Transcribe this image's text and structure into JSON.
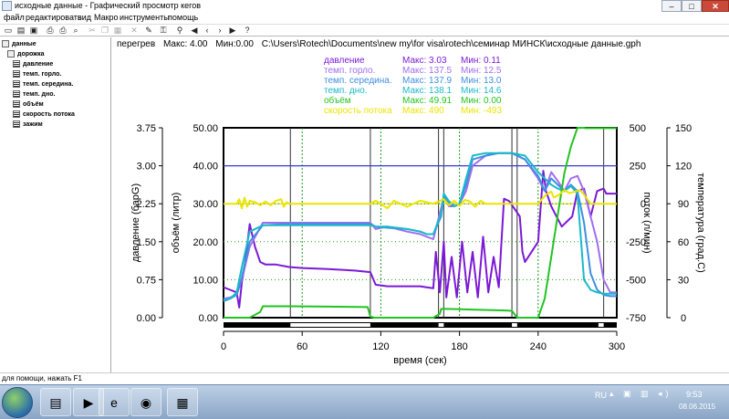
{
  "window": {
    "title": "исходные данные - Графический просмотр кегов",
    "min_label": "–",
    "max_label": "□",
    "close_label": "✕"
  },
  "menu": [
    "файл",
    "редактировать",
    "вид",
    "Макро",
    "инструменты",
    "помощь"
  ],
  "toolbar_icons": [
    "new-icon",
    "open-icon",
    "save-icon",
    "print-preview-icon",
    "print-icon",
    "search-icon",
    "cut-icon",
    "copy-icon",
    "paste-icon",
    "delete-icon",
    "pen-icon",
    "key-icon",
    "arrow-left-icon",
    "arrow-left-small-icon",
    "arrow-right-small-icon",
    "arrow-right-icon",
    "help-icon"
  ],
  "tree": {
    "root": "данные",
    "branch": "дорожка",
    "channels": [
      "давление",
      "темп. горло.",
      "темп. середина.",
      "темп. дно.",
      "объём",
      "скорость потока",
      "зажим"
    ]
  },
  "header": {
    "label": "перегрев",
    "max": "Макс: 4.00",
    "min": "Мин:0.00",
    "path": "C:\\Users\\Rotech\\Documents\\new my\\for visa\\rotech\\семинар МИНСК\\исходные данные.gph"
  },
  "legend": [
    {
      "name": "давление",
      "max": "Макс: 3.03",
      "min": "Мин: 0.11",
      "color": "#7b19d6"
    },
    {
      "name": "темп. горло.",
      "max": "Макс: 137.5",
      "min": "Мин: 12.5",
      "color": "#a16ef0"
    },
    {
      "name": "темп. середина.",
      "max": "Макс: 137.9",
      "min": "Мин: 13.0",
      "color": "#3f8fe0"
    },
    {
      "name": "темп. дно.",
      "max": "Макс: 138.1",
      "min": "Мин: 14.6",
      "color": "#19b9c9"
    },
    {
      "name": "объём",
      "max": "Макс: 49.91",
      "min": "Мин: 0.00",
      "color": "#22c322"
    },
    {
      "name": "скорость потока",
      "max": "Макс: 490",
      "min": "Мин: -493",
      "color": "#ece400"
    }
  ],
  "chart_data": {
    "type": "line",
    "x": {
      "label": "время (сек)",
      "range": [
        0,
        300
      ],
      "ticks": [
        "0",
        "60",
        "120",
        "180",
        "240",
        "300"
      ]
    },
    "y_pressure": {
      "label": "давление (барG)",
      "range": [
        0,
        3.75
      ],
      "ticks": [
        "0.00",
        "0.75",
        "1.50",
        "2.25",
        "3.00",
        "3.75"
      ]
    },
    "y_volume": {
      "label": "объём (литр)",
      "range": [
        0,
        50
      ],
      "ticks": [
        "0.00",
        "10.00",
        "20.00",
        "30.00",
        "40.00",
        "50.00"
      ]
    },
    "y_flow": {
      "label": "поток (л/мин)",
      "range": [
        -750,
        500
      ],
      "ticks": [
        "-750",
        "-500",
        "-250",
        "0",
        "250",
        "500"
      ]
    },
    "y_temp": {
      "label": "температура (град.C)",
      "range": [
        0,
        150
      ],
      "ticks": [
        "0",
        "30",
        "60",
        "90",
        "120",
        "150"
      ]
    },
    "horizontal_refs": [
      {
        "axis": "volume",
        "value": 40,
        "color": "#3a3ad0"
      },
      {
        "axis": "flow",
        "value": 0,
        "color": "#d8d800"
      }
    ],
    "vertical_lines": [
      {
        "t": 51,
        "style": "solid"
      },
      {
        "t": 60,
        "style": "dotted"
      },
      {
        "t": 112,
        "style": "solid"
      },
      {
        "t": 120,
        "style": "dotted"
      },
      {
        "t": 164,
        "style": "solid"
      },
      {
        "t": 168,
        "style": "solid"
      },
      {
        "t": 180,
        "style": "dotted"
      },
      {
        "t": 220,
        "style": "solid"
      },
      {
        "t": 224,
        "style": "solid"
      },
      {
        "t": 240,
        "style": "dotted"
      },
      {
        "t": 290,
        "style": "solid"
      }
    ],
    "timeline_white": [
      [
        51,
        112
      ],
      [
        164,
        168
      ],
      [
        220,
        224
      ],
      [
        286,
        290
      ]
    ],
    "series": [
      {
        "name": "давление",
        "axis": "pressure",
        "color": "#7b19d6",
        "x": [
          0,
          5,
          10,
          12,
          14,
          16,
          20,
          24,
          28,
          32,
          36,
          40,
          50,
          60,
          80,
          100,
          112,
          116,
          125,
          140,
          150,
          155,
          160,
          162,
          165,
          168,
          170,
          174,
          178,
          182,
          186,
          190,
          194,
          198,
          202,
          206,
          210,
          214,
          218,
          222,
          226,
          228,
          230,
          235,
          240,
          244,
          246,
          250,
          254,
          258,
          262,
          266,
          270,
          275,
          280,
          285,
          290,
          292,
          296,
          300
        ],
        "y": [
          0.6,
          0.55,
          0.5,
          0.2,
          0.7,
          1.0,
          1.85,
          1.4,
          1.1,
          1.05,
          1.05,
          1.05,
          1.0,
          0.98,
          0.96,
          0.93,
          0.9,
          0.65,
          0.62,
          0.62,
          0.62,
          0.6,
          0.58,
          1.3,
          0.5,
          1.5,
          0.4,
          1.2,
          0.4,
          1.5,
          0.5,
          1.3,
          0.4,
          1.6,
          0.5,
          1.2,
          0.6,
          2.35,
          2.3,
          2.15,
          2.0,
          1.3,
          1.1,
          1.3,
          1.5,
          2.9,
          2.5,
          2.2,
          2.0,
          1.8,
          1.9,
          2.0,
          2.5,
          2.55,
          2.0,
          2.5,
          2.55,
          2.45,
          2.45,
          2.45
        ]
      },
      {
        "name": "темп. горло.",
        "axis": "temp",
        "color": "#a16ef0",
        "x": [
          0,
          5,
          10,
          14,
          20,
          30,
          50,
          70,
          100,
          112,
          116,
          125,
          140,
          150,
          155,
          160,
          168,
          172,
          176,
          180,
          185,
          190,
          200,
          210,
          220,
          230,
          240,
          245,
          250,
          255,
          260,
          265,
          270,
          275,
          280,
          285,
          290,
          295,
          300
        ],
        "y": [
          15,
          16,
          18,
          30,
          56,
          75,
          75,
          75,
          75,
          75,
          70,
          72,
          68,
          66,
          64,
          62,
          95,
          88,
          88,
          90,
          100,
          120,
          128,
          130,
          130,
          125,
          110,
          100,
          115,
          108,
          100,
          110,
          112,
          100,
          80,
          60,
          30,
          20,
          20
        ]
      },
      {
        "name": "темп. середина.",
        "axis": "temp",
        "color": "#3f8fe0",
        "x": [
          0,
          5,
          10,
          14,
          20,
          30,
          50,
          70,
          100,
          112,
          116,
          125,
          140,
          150,
          155,
          160,
          166,
          168,
          172,
          176,
          180,
          185,
          190,
          200,
          210,
          220,
          230,
          240,
          245,
          250,
          255,
          260,
          265,
          270,
          275,
          280,
          285,
          290,
          295,
          300
        ],
        "y": [
          13,
          15,
          18,
          32,
          60,
          73,
          74,
          74,
          74,
          74,
          72,
          71,
          70,
          68,
          66,
          66,
          80,
          96,
          90,
          88,
          90,
          105,
          125,
          128,
          130,
          130,
          125,
          112,
          100,
          110,
          105,
          100,
          105,
          100,
          75,
          35,
          22,
          18,
          17,
          17
        ]
      },
      {
        "name": "темп. дно.",
        "axis": "temp",
        "color": "#19b9c9",
        "x": [
          0,
          5,
          10,
          14,
          20,
          30,
          50,
          70,
          100,
          112,
          116,
          125,
          140,
          150,
          155,
          160,
          166,
          168,
          172,
          176,
          180,
          185,
          190,
          200,
          210,
          220,
          230,
          240,
          245,
          250,
          255,
          260,
          265,
          270,
          275,
          280,
          285,
          290,
          295,
          300
        ],
        "y": [
          14,
          15,
          20,
          40,
          68,
          73,
          73,
          73,
          73,
          73,
          72,
          72,
          70,
          68,
          66,
          66,
          82,
          98,
          92,
          88,
          90,
          110,
          128,
          130,
          130,
          130,
          128,
          115,
          110,
          105,
          102,
          100,
          104,
          98,
          30,
          22,
          20,
          19,
          19,
          19
        ]
      },
      {
        "name": "объём",
        "axis": "volume",
        "color": "#22c322",
        "x": [
          0,
          20,
          28,
          30,
          50,
          80,
          110,
          112,
          115,
          160,
          165,
          166,
          170,
          205,
          215,
          220,
          224,
          225,
          230,
          240,
          245,
          250,
          255,
          260,
          265,
          270,
          275,
          276,
          280,
          300
        ],
        "y": [
          0,
          0,
          1.5,
          3,
          3,
          2.9,
          2.8,
          0.3,
          0,
          0,
          1.0,
          2.3,
          2.3,
          2.0,
          1.9,
          1.8,
          0,
          0,
          0,
          0,
          5,
          16,
          27,
          38,
          45,
          50,
          50,
          49.9,
          49.9,
          49.9
        ]
      },
      {
        "name": "скорость потока",
        "axis": "flow",
        "color": "#ece400",
        "x": [
          0,
          10,
          12,
          14,
          16,
          18,
          20,
          24,
          28,
          32,
          36,
          40,
          44,
          46,
          48,
          50,
          60,
          112,
          116,
          125,
          130,
          140,
          150,
          160,
          168,
          172,
          176,
          180,
          184,
          188,
          192,
          196,
          200,
          210,
          220,
          224,
          240,
          246,
          250,
          252,
          256,
          260,
          264,
          268,
          272,
          275,
          280,
          300
        ],
        "y": [
          0,
          0,
          30,
          -30,
          40,
          -20,
          20,
          10,
          -10,
          15,
          -10,
          20,
          30,
          -20,
          10,
          0,
          0,
          0,
          20,
          -30,
          20,
          -20,
          20,
          0,
          30,
          -10,
          20,
          -15,
          25,
          15,
          -20,
          20,
          0,
          0,
          0,
          0,
          0,
          60,
          80,
          40,
          60,
          90,
          70,
          80,
          90,
          60,
          0,
          0
        ]
      }
    ]
  }
}
